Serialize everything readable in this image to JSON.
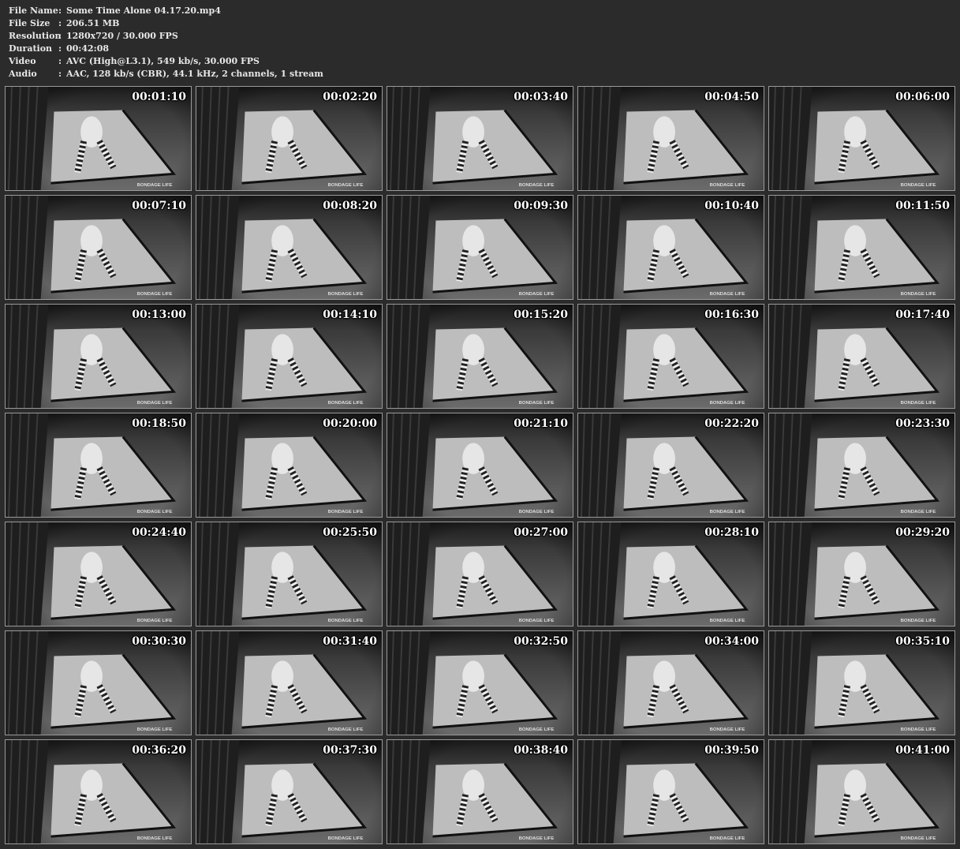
{
  "info": [
    {
      "key": "File Name",
      "sep": ":",
      "value": "Some Time Alone 04.17.20.mp4"
    },
    {
      "key": "File Size",
      "sep": ":",
      "value": "206.51 MB"
    },
    {
      "key": "Resolution",
      "sep": ":",
      "value": "1280x720 / 30.000 FPS"
    },
    {
      "key": "Duration",
      "sep": ":",
      "value": "00:42:08"
    },
    {
      "key": "Video",
      "sep": ":",
      "value": "AVC (High@L3.1), 549 kb/s, 30.000 FPS"
    },
    {
      "key": "Audio",
      "sep": ":",
      "value": "AAC, 128 kb/s (CBR), 44.1 kHz, 2 channels, 1 stream"
    }
  ],
  "watermark": "BONDAGE LIFE",
  "thumbnails": [
    "00:01:10",
    "00:02:20",
    "00:03:40",
    "00:04:50",
    "00:06:00",
    "00:07:10",
    "00:08:20",
    "00:09:30",
    "00:10:40",
    "00:11:50",
    "00:13:00",
    "00:14:10",
    "00:15:20",
    "00:16:30",
    "00:17:40",
    "00:18:50",
    "00:20:00",
    "00:21:10",
    "00:22:20",
    "00:23:30",
    "00:24:40",
    "00:25:50",
    "00:27:00",
    "00:28:10",
    "00:29:20",
    "00:30:30",
    "00:31:40",
    "00:32:50",
    "00:34:00",
    "00:35:10",
    "00:36:20",
    "00:37:30",
    "00:38:40",
    "00:39:50",
    "00:41:00"
  ]
}
